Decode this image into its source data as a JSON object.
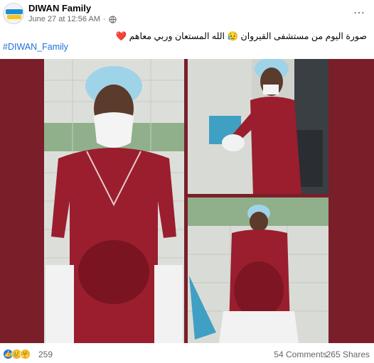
{
  "post": {
    "author": "DIWAN Family",
    "timestamp": "June 27 at 12:56 AM",
    "dot": "·",
    "more_icon": "⋯",
    "caption": "صورة اليوم من مستشفى القيروان 😥 الله المستعان وربي معاهم ❤️",
    "hashtag": "#DIWAN_Family"
  },
  "footer": {
    "reaction_count": "259",
    "comments": "54 Comments",
    "shares": "265 Shares"
  },
  "icons": {
    "avatar": "page-logo-icon",
    "privacy": "globe-icon",
    "reactions": [
      "like-icon",
      "sad-icon",
      "care-icon"
    ]
  },
  "colors": {
    "background_panel": "#7a1f2a",
    "scrub": "#9a1e2e",
    "link": "#216fdb",
    "meta": "#65676b",
    "like": "#1877f2"
  }
}
